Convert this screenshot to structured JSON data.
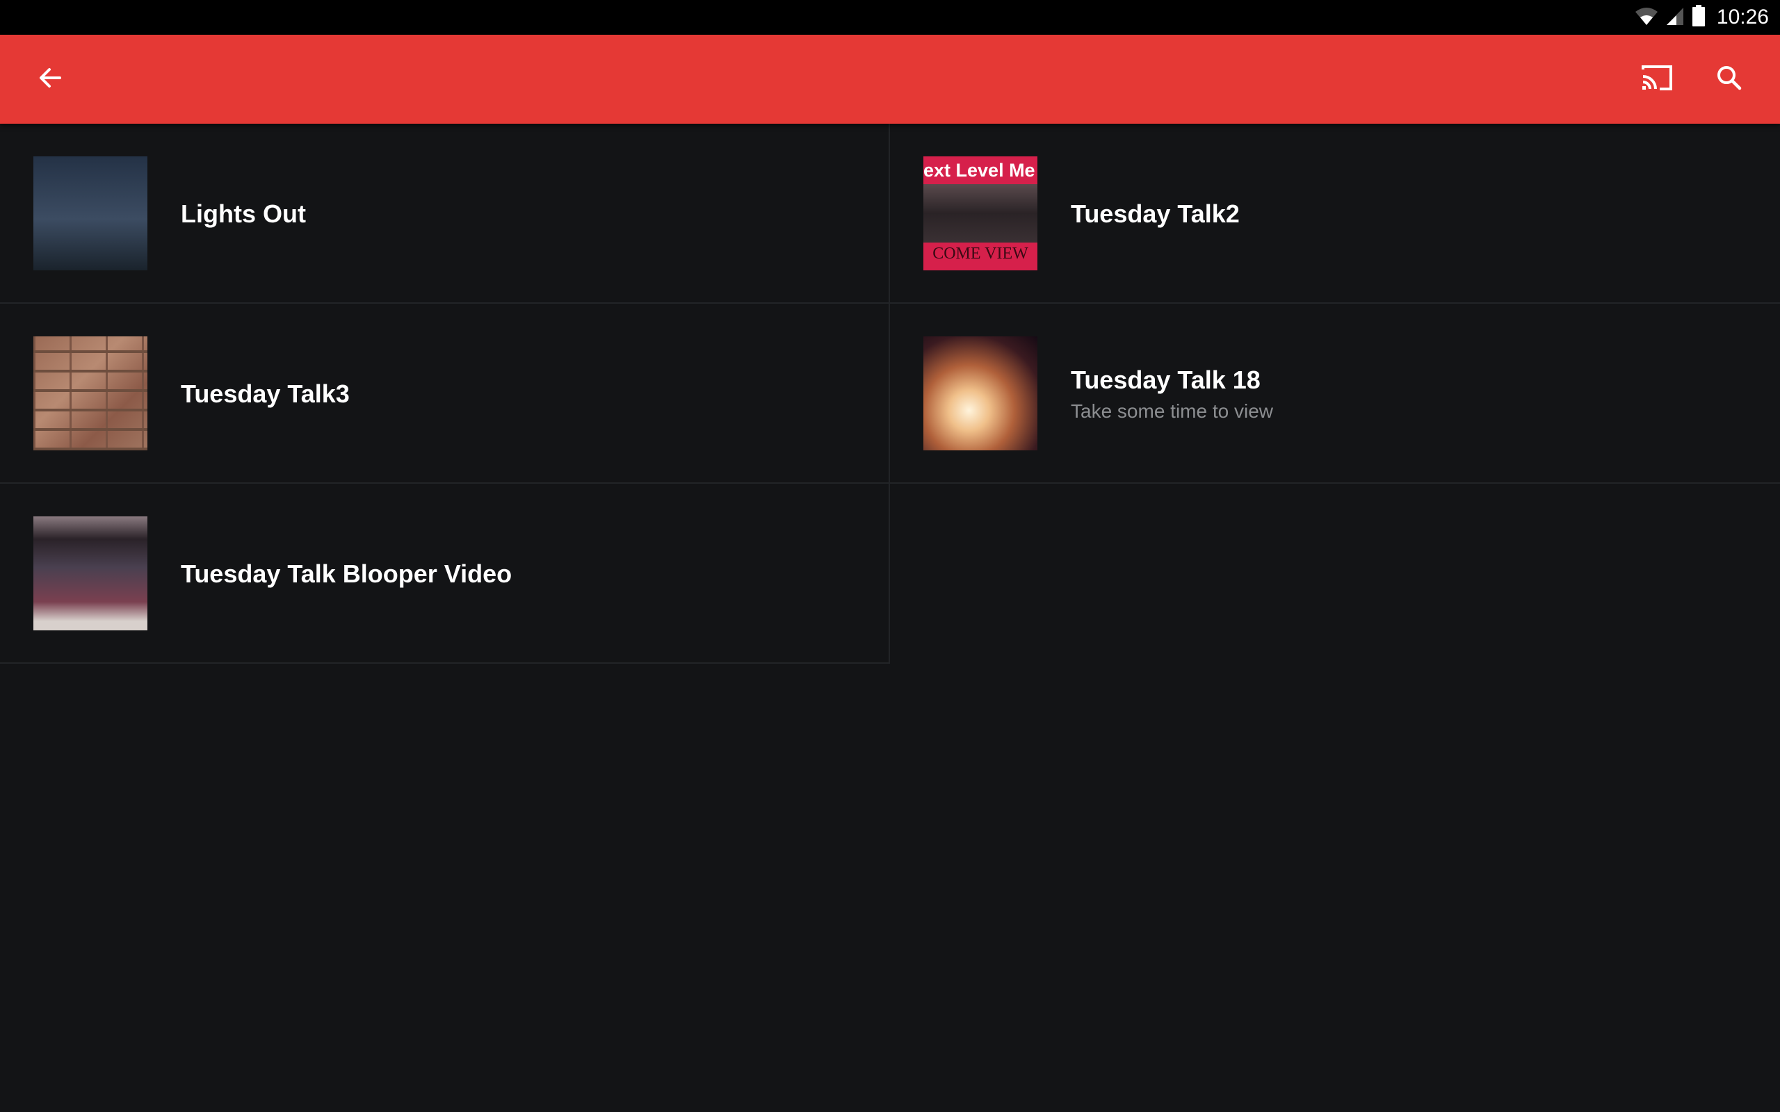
{
  "status_bar": {
    "time": "10:26",
    "icons": [
      "wifi-icon",
      "cellular-signal-icon",
      "battery-icon"
    ]
  },
  "toolbar": {
    "back_icon": "arrow-left-icon",
    "cast_icon": "cast-icon",
    "search_icon": "search-icon",
    "color": "#e53935"
  },
  "items": [
    {
      "title": "Lights Out",
      "subtitle": ""
    },
    {
      "title": "Tuesday Talk2",
      "subtitle": "",
      "thumb_text_top": "ext Level Me",
      "thumb_text_bottom": "COME VIEW"
    },
    {
      "title": "Tuesday Talk3",
      "subtitle": ""
    },
    {
      "title": "Tuesday Talk 18",
      "subtitle": "Take some time to view"
    },
    {
      "title": "Tuesday Talk Blooper Video",
      "subtitle": ""
    }
  ]
}
